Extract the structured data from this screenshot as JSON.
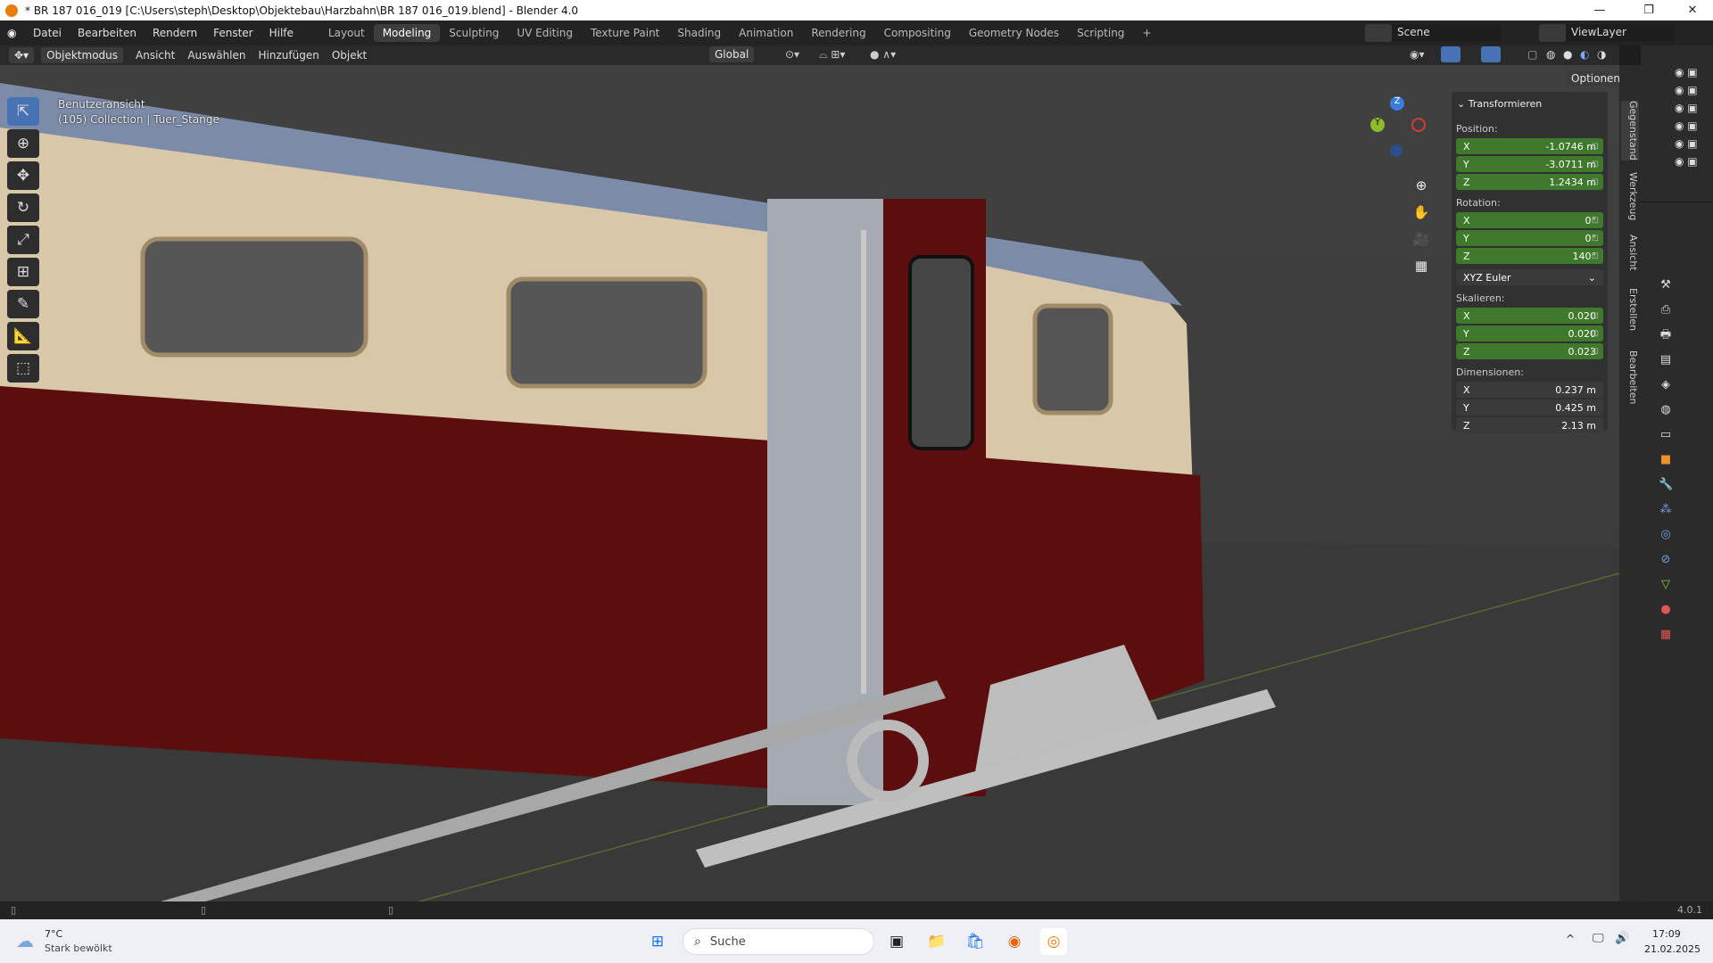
{
  "window": {
    "title": "* BR 187 016_019 [C:\\Users\\steph\\Desktop\\Objektebau\\Harzbahn\\BR 187 016_019.blend] - Blender 4.0"
  },
  "menu": [
    "Datei",
    "Bearbeiten",
    "Rendern",
    "Fenster",
    "Hilfe"
  ],
  "workspaces": [
    "Layout",
    "Modeling",
    "Sculpting",
    "UV Editing",
    "Texture Paint",
    "Shading",
    "Animation",
    "Rendering",
    "Compositing",
    "Geometry Nodes",
    "Scripting"
  ],
  "scene": {
    "label": "Scene",
    "view_layer": "ViewLayer"
  },
  "header": {
    "mode": "Objektmodus",
    "items": [
      "Ansicht",
      "Auswählen",
      "Hinzufügen",
      "Objekt"
    ],
    "orientation": "Global",
    "options": "Optionen"
  },
  "overlay": {
    "view_name": "Benutzeransicht",
    "collection": "(105) Collection | Tuer_Stange"
  },
  "gizmo": {
    "z": "Z",
    "y": "Y"
  },
  "npanel": {
    "section": "Transformieren",
    "position_label": "Position:",
    "position": [
      {
        "axis": "X",
        "value": "-1.0746 m"
      },
      {
        "axis": "Y",
        "value": "-3.0711 m"
      },
      {
        "axis": "Z",
        "value": "1.2434 m"
      }
    ],
    "rotation_label": "Rotation:",
    "rotation": [
      {
        "axis": "X",
        "value": "0°"
      },
      {
        "axis": "Y",
        "value": "0°"
      },
      {
        "axis": "Z",
        "value": "140°"
      }
    ],
    "rotation_mode": "XYZ Euler",
    "scale_label": "Skalieren:",
    "scale": [
      {
        "axis": "X",
        "value": "0.020"
      },
      {
        "axis": "Y",
        "value": "0.020"
      },
      {
        "axis": "Z",
        "value": "0.023"
      }
    ],
    "dimensions_label": "Dimensionen:",
    "dimensions": [
      {
        "axis": "X",
        "value": "0.237 m"
      },
      {
        "axis": "Y",
        "value": "0.425 m"
      },
      {
        "axis": "Z",
        "value": "2.13 m"
      }
    ]
  },
  "side_tabs": [
    "Gegenstand",
    "Werkzeug",
    "Ansicht",
    "Erstellen",
    "Bearbeiten"
  ],
  "status": {
    "version": "4.0.1"
  },
  "taskbar": {
    "weather_temp": "7°C",
    "weather_desc": "Stark bewölkt",
    "search": "Suche",
    "time": "17:09",
    "date": "21.02.2025"
  }
}
